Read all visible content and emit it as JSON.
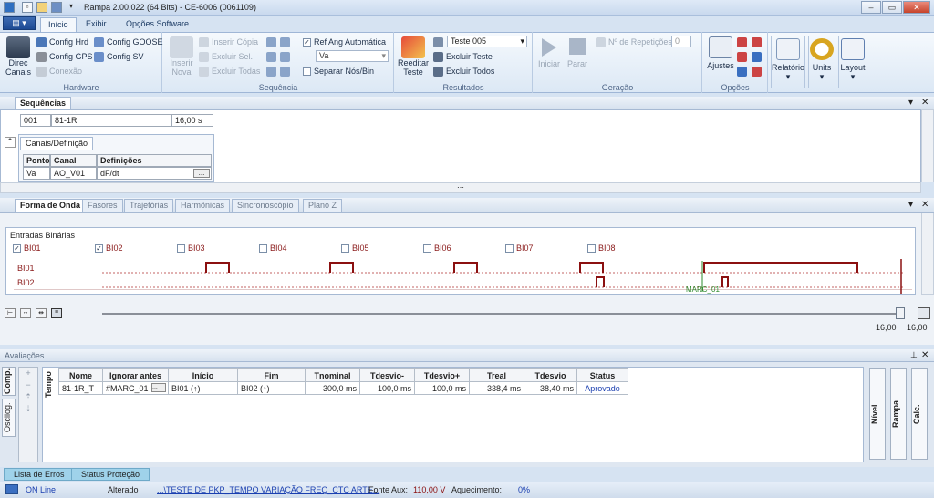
{
  "window": {
    "title": "Rampa 2.00.022 (64 Bits) - CE-6006 (0061109)"
  },
  "ribbon_tabs": [
    "Início",
    "Exibir",
    "Opções Software"
  ],
  "app_button": "▤ ▾",
  "hardware": {
    "direc_canais": [
      "Direc",
      "Canais"
    ],
    "config_hrd": "Config Hrd",
    "config_goose": "Config GOOSE",
    "config_gps": "Config GPS",
    "config_sv": "Config SV",
    "conexao": "Conexão",
    "label": "Hardware"
  },
  "sequencia": {
    "inserir_nova": [
      "Inserir",
      "Nova"
    ],
    "inserir_copia": "Inserir Cópia",
    "excluir_sel": "Excluir Sel.",
    "excluir_todas": "Excluir Todas",
    "ref_ang": "Ref Ang Automática",
    "ref_ang_value": "Va",
    "separar": "Separar Nós/Bin",
    "label": "Sequência"
  },
  "resultados": {
    "reeditar": [
      "Reeditar",
      "Teste"
    ],
    "teste_select": "Teste 005",
    "excluir_teste": "Excluir Teste",
    "excluir_todos": "Excluir Todos",
    "label": "Resultados"
  },
  "geracao": {
    "iniciar": "Iniciar",
    "parar": "Parar",
    "repeticoes": "Nº de Repetições",
    "repeticoes_value": "0",
    "label": "Geração"
  },
  "opcoes": {
    "ajustes": "Ajustes",
    "label": "Opções"
  },
  "extra": {
    "relatorio": "Relatório",
    "units": "Units",
    "layout": "Layout"
  },
  "sequencias_panel": {
    "tab": "Sequências",
    "row": {
      "id": "001",
      "name": "81-1R",
      "duration": "16,00 s"
    },
    "sub_tab": "Canais/Definição",
    "headers": [
      "Ponto",
      "Canal",
      "Definições"
    ],
    "channel": {
      "ponto": "Va",
      "canal": "AO_V01",
      "definicao": "dF/dt",
      "btn": "..."
    }
  },
  "wave_panel": {
    "tabs": [
      "Forma de Onda",
      "Fasores",
      "Trajetórias",
      "Harmônicas",
      "Sincronoscópio",
      "Plano Z"
    ],
    "entradas_label": "Entradas Binárias",
    "binaries": [
      {
        "name": "BI01",
        "checked": true
      },
      {
        "name": "BI02",
        "checked": true
      },
      {
        "name": "BI03",
        "checked": false
      },
      {
        "name": "BI04",
        "checked": false
      },
      {
        "name": "BI05",
        "checked": false
      },
      {
        "name": "BI06",
        "checked": false
      },
      {
        "name": "BI07",
        "checked": false
      },
      {
        "name": "BI08",
        "checked": false
      }
    ],
    "rows": [
      "BI01",
      "BI02"
    ],
    "marker": "MARC_01",
    "time_left": "16,00",
    "time_right": "16,00"
  },
  "avaliacoes": {
    "title": "Avaliações",
    "side_tabs": [
      "Comp.",
      "Oscilog."
    ],
    "tempo": "Tempo",
    "headers": [
      "Nome",
      "Ignorar antes",
      "Início",
      "Fim",
      "Tnominal",
      "Tdesvio-",
      "Tdesvio+",
      "Treal",
      "Tdesvio",
      "Status"
    ],
    "row": {
      "nome": "81-1R_T",
      "ignorar": "#MARC_01",
      "inicio": "BI01 (↑)",
      "fim": "BI02 (↑)",
      "tnominal": "300,0 ms",
      "tdesvio_minus": "100,0 ms",
      "tdesvio_plus": "100,0 ms",
      "treal": "338,4 ms",
      "tdesvio": "38,40 ms",
      "status": "Aprovado"
    },
    "right_btns": [
      "Nível",
      "Rampa",
      "Calc."
    ]
  },
  "bottom_tabs": [
    "Lista de Erros",
    "Status Proteção"
  ],
  "status": {
    "online": "ON Line",
    "alterado": "Alterado",
    "path": "...\\TESTE DE PKP_TEMPO VARIAÇÃO FREQ_CTC ARTE...",
    "fonte_label": "Fonte Aux:",
    "fonte_value": "110,00 V",
    "aquec_label": "Aquecimento:",
    "aquec_value": "0%"
  },
  "colors": {
    "accent": "#1d4a93",
    "trace": "#8b1010",
    "marker": "#2e8b2e",
    "status_ok": "#1a3fb0"
  }
}
